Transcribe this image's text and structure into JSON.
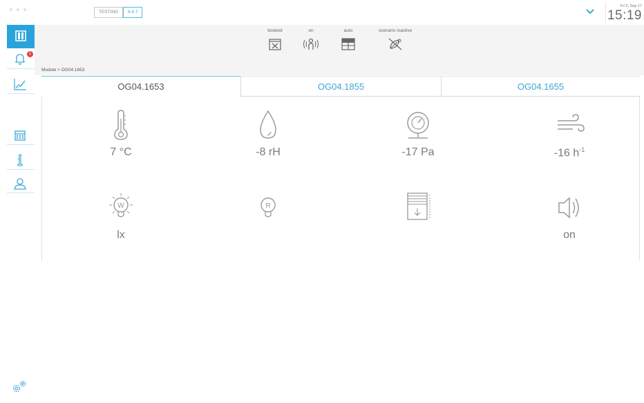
{
  "header": {
    "badge_testing": "TESTING",
    "badge_version": "8.6.7",
    "date": "Fri 5, Sep 17",
    "time": "15:19"
  },
  "sidebar": {
    "notification_count": "1",
    "icons": [
      "panel-icon",
      "bell-icon",
      "chart-icon",
      "calendar-icon",
      "info-icon",
      "user-icon",
      "settings-icon"
    ]
  },
  "status": {
    "booked": "booked",
    "on": "on",
    "auto": "auto",
    "scenario": "scenario inactive"
  },
  "breadcrumb": "Module > OG04.1653",
  "tabs": [
    {
      "label": "OG04.1653",
      "active": true
    },
    {
      "label": "OG04.1855",
      "active": false
    },
    {
      "label": "OG04.1655",
      "active": false
    }
  ],
  "readings": {
    "temperature": "7 °C",
    "humidity": "-8 rH",
    "pressure": "-17 Pa",
    "air_change": "-16 h",
    "air_change_exp": "-1",
    "illuminance": "lx",
    "sound": "on"
  },
  "colors": {
    "accent": "#29a3dc",
    "alert": "#e34343",
    "icon_gray": "#9a9a9a"
  }
}
